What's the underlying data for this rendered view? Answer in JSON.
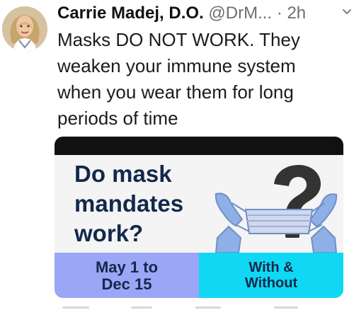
{
  "tweet": {
    "author_name": "Carrie Madej, D.O.",
    "handle": "@DrM...",
    "separator": "·",
    "time": "2h",
    "text_lines": [
      "Masks DO NOT WORK. They",
      "weaken your immune system",
      "when you wear them for long",
      "periods of time"
    ]
  },
  "card": {
    "title_lines": [
      "Do mask",
      "mandates",
      "work?"
    ],
    "left_label_lines": [
      "May 1 to",
      "Dec 15"
    ],
    "right_label_lines": [
      "With &",
      "Without"
    ],
    "colors": {
      "title": "#13294b",
      "left_panel": "#9ba6f6",
      "right_panel": "#10d8f4",
      "question_mark": "#333333",
      "mask": "#cfd8ec",
      "hands": "#8fb0e6"
    },
    "icons": [
      "question-mark-illustration",
      "mask-illustration",
      "hand-icon"
    ]
  },
  "ui": {
    "menu_icon": "chevron-down-icon"
  }
}
